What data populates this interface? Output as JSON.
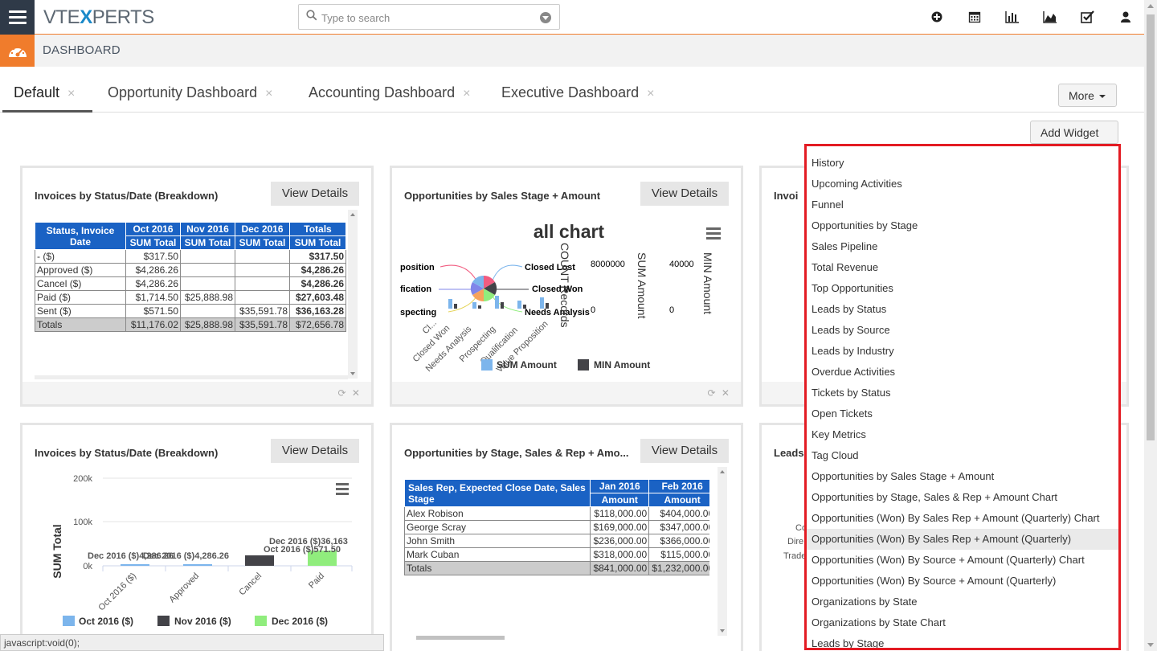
{
  "app": {
    "logo_left": "VTE",
    "logo_x": "X",
    "logo_right": "PERTS",
    "module_title": "DASHBOARD"
  },
  "search": {
    "placeholder": "Type to search"
  },
  "tabs": [
    {
      "label": "Default",
      "close": "×"
    },
    {
      "label": "Opportunity Dashboard",
      "close": "×"
    },
    {
      "label": "Accounting Dashboard",
      "close": "×"
    },
    {
      "label": "Executive Dashboard",
      "close": "×"
    }
  ],
  "buttons": {
    "more": "More",
    "add_widget": "Add Widget",
    "view_details": "View Details"
  },
  "widgets": {
    "w1": {
      "title": "Invoices by Status/Date (Breakdown)",
      "headers_top": [
        "Status, Invoice Date",
        "Oct 2016",
        "Nov 2016",
        "Dec 2016",
        "Totals"
      ],
      "headers_sub": [
        "SUM Total",
        "SUM Total",
        "SUM Total",
        "SUM Total"
      ],
      "rows": [
        [
          "- ($)",
          "$317.50",
          "",
          "",
          "$317.50"
        ],
        [
          "Approved ($)",
          "$4,286.26",
          "",
          "",
          "$4,286.26"
        ],
        [
          "Cancel ($)",
          "$4,286.26",
          "",
          "",
          "$4,286.26"
        ],
        [
          "Paid ($)",
          "$1,714.50",
          "$25,888.98",
          "",
          "$27,603.48"
        ],
        [
          "Sent ($)",
          "$571.50",
          "",
          "$35,591.78",
          "$36,163.28"
        ]
      ],
      "totals": [
        "Totals",
        "$11,176.02",
        "$25,888.98",
        "$35,591.78",
        "$72,656.78"
      ]
    },
    "w2": {
      "title": "Opportunities by Sales Stage + Amount",
      "chart_title": "all chart",
      "pie_labels": [
        "position",
        "fication",
        "specting",
        "Closed Lost",
        "Closed Won",
        "Needs Analysis"
      ],
      "axis_labels": [
        "COUNT Records",
        "SUM Amount",
        "MIN Amount"
      ],
      "axis_values": [
        "8000000",
        "40000",
        "0",
        "0"
      ],
      "x_ticks": [
        "Cl...",
        "Closed Won",
        "Needs Analysis",
        "Prospecting",
        "Qualification",
        "Value Proposition"
      ],
      "legend": [
        "SUM Amount",
        "MIN Amount"
      ],
      "colors": {
        "series1": "#7cb5ec",
        "series2": "#434348"
      }
    },
    "w3": {
      "title": "Invoi"
    },
    "w4": {
      "title": "Invoices by Status/Date (Breakdown)",
      "ylabel": "SUM Total",
      "yticks": [
        "200k",
        "100k",
        "0k"
      ],
      "categories": [
        "Oct 2016 ($)",
        "Approved",
        "Cancel",
        "Paid"
      ],
      "data_labels": [
        "Dec 2016 ($)4,286.26",
        "Dec 2016 ($)4,286.26",
        "Dec 2016 ($)36,163",
        "Oct 2016 ($)571.50"
      ],
      "legend": [
        "Oct 2016 ($)",
        "Nov 2016 ($)",
        "Dec 2016 ($)"
      ],
      "colors": [
        "#7cb5ec",
        "#434348",
        "#90ed7d"
      ]
    },
    "w5": {
      "title": "Opportunities by Stage, Sales & Rep + Amo...",
      "headers_top": [
        "Sales Rep, Expected Close Date, Sales Stage",
        "Jan 2016",
        "Feb 2016"
      ],
      "headers_sub": [
        "Amount",
        "Amount"
      ],
      "rows": [
        [
          "Alex Robison",
          "$118,000.00",
          "$404,000.00"
        ],
        [
          "George Scray",
          "$169,000.00",
          "$347,000.00"
        ],
        [
          "John Smith",
          "$236,000.00",
          "$366,000.00"
        ],
        [
          "Mark Cuban",
          "$318,000.00",
          "$115,000.00"
        ]
      ],
      "totals": [
        "Totals",
        "$841,000.00",
        "$1,232,000.00",
        "$"
      ]
    },
    "w6": {
      "title": "Leads",
      "fragments": [
        "Co",
        "Dire",
        "Trade"
      ]
    }
  },
  "menu": [
    "History",
    "Upcoming Activities",
    "Funnel",
    "Opportunities by Stage",
    "Sales Pipeline",
    "Total Revenue",
    "Top Opportunities",
    "Leads by Status",
    "Leads by Source",
    "Leads by Industry",
    "Overdue Activities",
    "Tickets by Status",
    "Open Tickets",
    "Key Metrics",
    "Tag Cloud",
    "Opportunities by Sales Stage + Amount",
    "Opportunities by Stage, Sales & Rep + Amount Chart",
    "Opportunities (Won) By Sales Rep + Amount (Quarterly) Chart",
    "Opportunities (Won) By Sales Rep + Amount (Quarterly)",
    "Opportunities (Won) By Source + Amount (Quarterly) Chart",
    "Opportunities (Won) By Source + Amount (Quarterly)",
    "Organizations by State",
    "Organizations by State Chart",
    "Leads by Stage"
  ],
  "status_bar": "javascript:void(0);"
}
